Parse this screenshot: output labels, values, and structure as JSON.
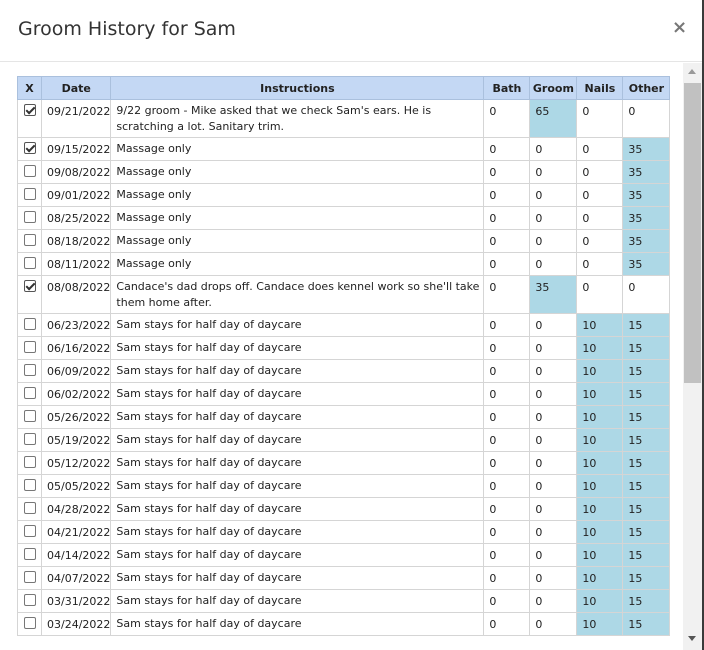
{
  "dialog": {
    "title": "Groom History for Sam",
    "close_icon": "×"
  },
  "columns": [
    "X",
    "Date",
    "Instructions",
    "Bath",
    "Groom",
    "Nails",
    "Other"
  ],
  "rows": [
    {
      "checked": true,
      "date": "09/21/2022",
      "instructions": "9/22 groom - Mike asked that we check Sam's ears.  He is scratching a lot.  Sanitary trim.",
      "bath": "0",
      "groom": "65",
      "nails": "0",
      "other": "0",
      "hl": "groom",
      "tall": true
    },
    {
      "checked": true,
      "date": "09/15/2022",
      "instructions": "Massage only",
      "bath": "0",
      "groom": "0",
      "nails": "0",
      "other": "35",
      "hl": "other"
    },
    {
      "checked": false,
      "date": "09/08/2022",
      "instructions": "Massage only",
      "bath": "0",
      "groom": "0",
      "nails": "0",
      "other": "35",
      "hl": "other"
    },
    {
      "checked": false,
      "date": "09/01/2022",
      "instructions": "Massage only",
      "bath": "0",
      "groom": "0",
      "nails": "0",
      "other": "35",
      "hl": "other"
    },
    {
      "checked": false,
      "date": "08/25/2022",
      "instructions": "Massage only",
      "bath": "0",
      "groom": "0",
      "nails": "0",
      "other": "35",
      "hl": "other"
    },
    {
      "checked": false,
      "date": "08/18/2022",
      "instructions": "Massage only",
      "bath": "0",
      "groom": "0",
      "nails": "0",
      "other": "35",
      "hl": "other"
    },
    {
      "checked": false,
      "date": "08/11/2022",
      "instructions": "Massage only",
      "bath": "0",
      "groom": "0",
      "nails": "0",
      "other": "35",
      "hl": "other"
    },
    {
      "checked": true,
      "date": "08/08/2022",
      "instructions": "Candace's dad drops off.  Candace does kennel work so she'll take them home after.",
      "bath": "0",
      "groom": "35",
      "nails": "0",
      "other": "0",
      "hl": "groom",
      "tall": true
    },
    {
      "checked": false,
      "date": "06/23/2022",
      "instructions": "Sam stays for half day of daycare",
      "bath": "0",
      "groom": "0",
      "nails": "10",
      "other": "15",
      "hl": "nails-other"
    },
    {
      "checked": false,
      "date": "06/16/2022",
      "instructions": "Sam stays for half day of daycare",
      "bath": "0",
      "groom": "0",
      "nails": "10",
      "other": "15",
      "hl": "nails-other"
    },
    {
      "checked": false,
      "date": "06/09/2022",
      "instructions": "Sam stays for half day of daycare",
      "bath": "0",
      "groom": "0",
      "nails": "10",
      "other": "15",
      "hl": "nails-other"
    },
    {
      "checked": false,
      "date": "06/02/2022",
      "instructions": "Sam stays for half day of daycare",
      "bath": "0",
      "groom": "0",
      "nails": "10",
      "other": "15",
      "hl": "nails-other"
    },
    {
      "checked": false,
      "date": "05/26/2022",
      "instructions": "Sam stays for half day of daycare",
      "bath": "0",
      "groom": "0",
      "nails": "10",
      "other": "15",
      "hl": "nails-other"
    },
    {
      "checked": false,
      "date": "05/19/2022",
      "instructions": "Sam stays for half day of daycare",
      "bath": "0",
      "groom": "0",
      "nails": "10",
      "other": "15",
      "hl": "nails-other"
    },
    {
      "checked": false,
      "date": "05/12/2022",
      "instructions": "Sam stays for half day of daycare",
      "bath": "0",
      "groom": "0",
      "nails": "10",
      "other": "15",
      "hl": "nails-other"
    },
    {
      "checked": false,
      "date": "05/05/2022",
      "instructions": "Sam stays for half day of daycare",
      "bath": "0",
      "groom": "0",
      "nails": "10",
      "other": "15",
      "hl": "nails-other"
    },
    {
      "checked": false,
      "date": "04/28/2022",
      "instructions": "Sam stays for half day of daycare",
      "bath": "0",
      "groom": "0",
      "nails": "10",
      "other": "15",
      "hl": "nails-other"
    },
    {
      "checked": false,
      "date": "04/21/2022",
      "instructions": "Sam stays for half day of daycare",
      "bath": "0",
      "groom": "0",
      "nails": "10",
      "other": "15",
      "hl": "nails-other"
    },
    {
      "checked": false,
      "date": "04/14/2022",
      "instructions": "Sam stays for half day of daycare",
      "bath": "0",
      "groom": "0",
      "nails": "10",
      "other": "15",
      "hl": "nails-other"
    },
    {
      "checked": false,
      "date": "04/07/2022",
      "instructions": "Sam stays for half day of daycare",
      "bath": "0",
      "groom": "0",
      "nails": "10",
      "other": "15",
      "hl": "nails-other"
    },
    {
      "checked": false,
      "date": "03/31/2022",
      "instructions": "Sam stays for half day of daycare",
      "bath": "0",
      "groom": "0",
      "nails": "10",
      "other": "15",
      "hl": "nails-other"
    },
    {
      "checked": false,
      "date": "03/24/2022",
      "instructions": "Sam stays for half day of daycare",
      "bath": "0",
      "groom": "0",
      "nails": "10",
      "other": "15",
      "hl": "nails-other"
    }
  ],
  "colors": {
    "header_bg": "#c4d8f4",
    "highlight": "#add8e6"
  }
}
